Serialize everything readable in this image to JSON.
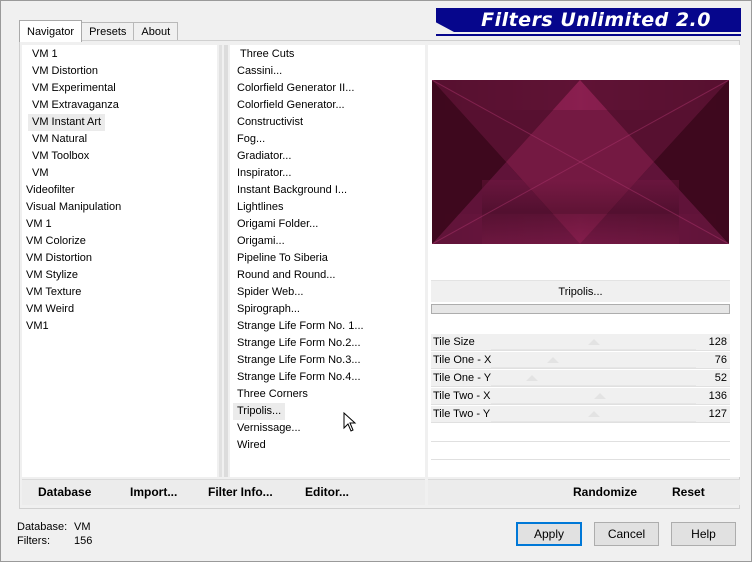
{
  "tabs": [
    "Navigator",
    "Presets",
    "About"
  ],
  "brand": "Filters Unlimited 2.0",
  "categories": [
    {
      "label": "VM 1",
      "indent": true
    },
    {
      "label": "VM Distortion",
      "indent": true
    },
    {
      "label": "VM Experimental",
      "indent": true
    },
    {
      "label": "VM Extravaganza",
      "indent": true
    },
    {
      "label": "VM Instant Art",
      "indent": true,
      "selected": true
    },
    {
      "label": "VM Natural",
      "indent": true
    },
    {
      "label": "VM Toolbox",
      "indent": true
    },
    {
      "label": "VM",
      "indent": true
    },
    {
      "label": "Videofilter",
      "indent": false
    },
    {
      "label": "Visual Manipulation",
      "indent": false
    },
    {
      "label": "VM 1",
      "indent": false
    },
    {
      "label": "VM Colorize",
      "indent": false
    },
    {
      "label": "VM Distortion",
      "indent": false
    },
    {
      "label": "VM Stylize",
      "indent": false
    },
    {
      "label": "VM Texture",
      "indent": false
    },
    {
      "label": "VM Weird",
      "indent": false
    },
    {
      "label": "VM1",
      "indent": false
    }
  ],
  "filters": [
    "Three Cuts",
    "Cassini...",
    "Colorfield Generator II...",
    "Colorfield Generator...",
    "Constructivist",
    "Fog...",
    "Gradiator...",
    "Inspirator...",
    "Instant Background I...",
    "Lightlines",
    "Origami Folder...",
    "Origami...",
    "Pipeline To Siberia",
    "Round and Round...",
    "Spider Web...",
    "Spirograph...",
    "Strange Life Form No. 1...",
    "Strange Life Form No.2...",
    "Strange Life Form No.3...",
    "Strange Life Form No.4...",
    "Three Corners",
    "Tripolis...",
    "Vernissage...",
    "Wired"
  ],
  "selected_filter_index": 21,
  "current_filter": "Tripolis...",
  "parameters": [
    {
      "label": "Tile Size",
      "value": "128",
      "level": 0.5
    },
    {
      "label": "Tile One - X",
      "value": "76",
      "level": 0.3
    },
    {
      "label": "Tile One - Y",
      "value": "52",
      "level": 0.2
    },
    {
      "label": "Tile Two - X",
      "value": "136",
      "level": 0.53
    },
    {
      "label": "Tile Two - Y",
      "value": "127",
      "level": 0.5
    }
  ],
  "toolbar": {
    "database": "Database",
    "import": "Import...",
    "filter_info": "Filter Info...",
    "editor": "Editor...",
    "randomize": "Randomize",
    "reset": "Reset"
  },
  "status": {
    "database_label": "Database:",
    "database_value": "VM",
    "filters_label": "Filters:",
    "filters_value": "156"
  },
  "buttons": {
    "apply": "Apply",
    "cancel": "Cancel",
    "help": "Help"
  },
  "colors": {
    "brand_bg": "#06068c",
    "accent": "#0078d7",
    "preview_base": "#2b0614",
    "preview_magenta": "#8e2052"
  }
}
